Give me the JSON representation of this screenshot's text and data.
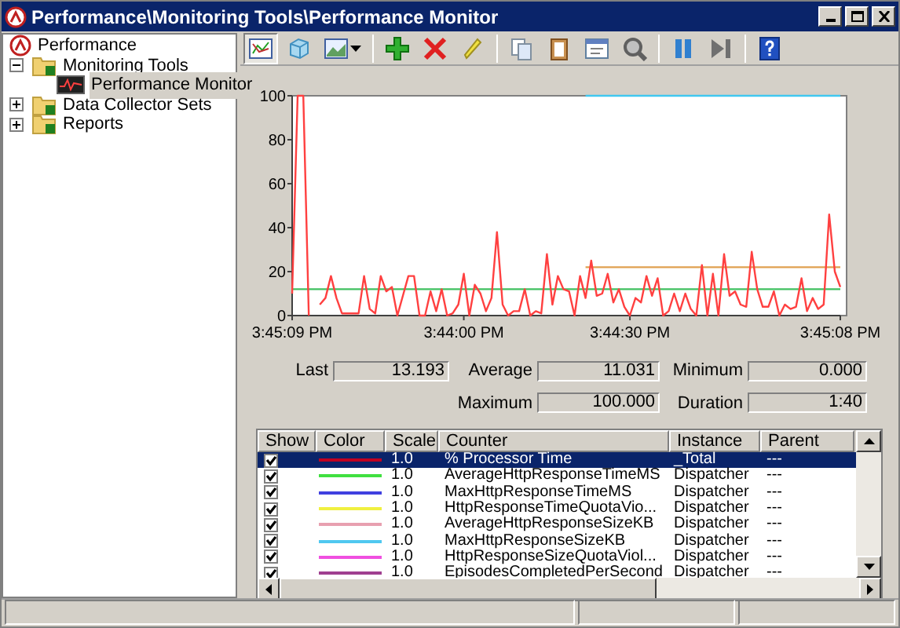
{
  "window": {
    "title": "Performance\\Monitoring Tools\\Performance Monitor"
  },
  "tree": [
    {
      "label": "Performance",
      "kind": "root",
      "selected": false,
      "children": [
        {
          "label": "Monitoring Tools",
          "kind": "folder",
          "selected": false,
          "expanded": true,
          "children": [
            {
              "label": "Performance Monitor",
              "kind": "monitor",
              "selected": true
            }
          ]
        },
        {
          "label": "Data Collector Sets",
          "kind": "folder",
          "selected": false,
          "expanded": false
        },
        {
          "label": "Reports",
          "kind": "folder",
          "selected": false,
          "expanded": false
        }
      ]
    }
  ],
  "toolbar": [
    {
      "kind": "graph",
      "selected": true
    },
    {
      "kind": "freeze",
      "selected": false
    },
    {
      "kind": "view",
      "selected": false
    },
    {
      "kind": "add",
      "selected": false
    },
    {
      "kind": "delete",
      "selected": false
    },
    {
      "kind": "highlight",
      "selected": false
    },
    {
      "kind": "copy",
      "selected": false
    },
    {
      "kind": "paste",
      "selected": false
    },
    {
      "kind": "properties",
      "selected": false
    },
    {
      "kind": "zoom",
      "selected": false
    },
    {
      "kind": "pause",
      "selected": false
    },
    {
      "kind": "step",
      "selected": false
    },
    {
      "kind": "help",
      "selected": false
    }
  ],
  "chart_data": {
    "type": "line",
    "categories": [
      "3:45:09 PM",
      null,
      null,
      null,
      null,
      null,
      null,
      null,
      null,
      null,
      null,
      null,
      null,
      null,
      null,
      null,
      null,
      null,
      null,
      null,
      null,
      null,
      null,
      null,
      null,
      null,
      null,
      null,
      null,
      null,
      null,
      "3:44:00 PM",
      null,
      null,
      null,
      null,
      null,
      null,
      null,
      null,
      null,
      null,
      null,
      null,
      null,
      null,
      null,
      null,
      null,
      null,
      null,
      null,
      null,
      null,
      null,
      null,
      null,
      null,
      null,
      null,
      null,
      "3:44:30 PM",
      null,
      null,
      null,
      null,
      null,
      null,
      null,
      null,
      null,
      null,
      null,
      null,
      null,
      null,
      null,
      null,
      null,
      null,
      null,
      null,
      null,
      null,
      null,
      null,
      null,
      null,
      null,
      null,
      null,
      null,
      null,
      null,
      null,
      null,
      null,
      null,
      null,
      "3:45:08 PM"
    ],
    "ylim": [
      0,
      100
    ],
    "yticks": [
      0,
      20,
      40,
      60,
      80,
      100
    ],
    "series": [
      {
        "color": "#ff4040",
        "values": [
          10,
          100,
          100,
          0,
          null,
          5,
          8,
          18,
          8,
          1,
          1,
          1,
          1,
          18,
          3,
          1,
          18,
          11,
          13,
          0,
          9,
          18,
          18,
          0,
          0,
          11,
          2,
          12,
          0,
          1,
          5,
          19,
          0,
          14,
          10,
          2,
          8,
          38,
          5,
          0,
          2,
          2,
          12,
          0,
          2,
          1,
          28,
          5,
          18,
          12,
          11,
          0,
          18,
          8,
          25,
          9,
          10,
          19,
          6,
          12,
          4,
          0,
          8,
          6,
          18,
          9,
          17,
          0,
          2,
          10,
          2,
          10,
          3,
          0,
          23,
          0,
          19,
          0,
          28,
          9,
          11,
          5,
          4,
          29,
          12,
          4,
          4,
          11,
          0,
          5,
          3,
          4,
          17,
          2,
          8,
          3,
          5,
          46,
          20,
          13
        ]
      },
      {
        "color": "#40c060",
        "values": [
          12,
          12,
          12,
          12,
          12,
          12,
          12,
          12,
          12,
          12,
          12,
          12,
          12,
          12,
          12,
          12,
          12,
          12,
          12,
          12,
          12,
          12,
          12,
          12,
          12,
          12,
          12,
          12,
          12,
          12,
          12,
          12,
          12,
          12,
          12,
          12,
          12,
          12,
          12,
          12,
          12,
          12,
          12,
          12,
          12,
          12,
          12,
          12,
          12,
          12,
          12,
          12,
          12,
          12,
          12,
          12,
          12,
          12,
          12,
          12,
          12,
          12,
          12,
          12,
          12,
          12,
          12,
          12,
          12,
          12,
          12,
          12,
          12,
          12,
          12,
          12,
          12,
          12,
          12,
          12,
          12,
          12,
          12,
          12,
          12,
          12,
          12,
          12,
          12,
          12,
          12,
          12,
          12,
          12,
          12,
          12,
          12,
          12,
          12,
          12
        ]
      },
      {
        "color": "#40c8f0",
        "values": [
          null,
          null,
          null,
          null,
          null,
          null,
          null,
          null,
          null,
          null,
          null,
          null,
          null,
          null,
          null,
          null,
          null,
          null,
          null,
          null,
          null,
          null,
          null,
          null,
          null,
          null,
          null,
          null,
          null,
          null,
          null,
          null,
          null,
          null,
          null,
          null,
          null,
          null,
          null,
          null,
          null,
          null,
          null,
          null,
          null,
          null,
          null,
          null,
          null,
          null,
          null,
          null,
          null,
          100,
          100,
          100,
          100,
          100,
          100,
          100,
          100,
          100,
          100,
          100,
          100,
          100,
          100,
          100,
          100,
          100,
          100,
          100,
          100,
          100,
          100,
          100,
          100,
          100,
          100,
          100,
          100,
          100,
          100,
          100,
          100,
          100,
          100,
          100,
          100,
          100,
          100,
          100,
          100,
          100,
          100,
          100,
          100,
          100,
          100,
          100
        ]
      },
      {
        "color": "#e0a050",
        "values": [
          null,
          null,
          null,
          null,
          null,
          null,
          null,
          null,
          null,
          null,
          null,
          null,
          null,
          null,
          null,
          null,
          null,
          null,
          null,
          null,
          null,
          null,
          null,
          null,
          null,
          null,
          null,
          null,
          null,
          null,
          null,
          null,
          null,
          null,
          null,
          null,
          null,
          null,
          null,
          null,
          null,
          null,
          null,
          null,
          null,
          null,
          null,
          null,
          null,
          null,
          null,
          null,
          null,
          22,
          22,
          22,
          22,
          22,
          22,
          22,
          22,
          22,
          22,
          22,
          22,
          22,
          22,
          22,
          22,
          22,
          22,
          22,
          22,
          22,
          22,
          22,
          22,
          22,
          22,
          22,
          22,
          22,
          22,
          22,
          22,
          22,
          22,
          22,
          22,
          22,
          22,
          22,
          22,
          22,
          22,
          22,
          22,
          22,
          22,
          22
        ]
      }
    ]
  },
  "stats": [
    {
      "label": "Last",
      "value": "13.193"
    },
    {
      "label": "Average",
      "value": "11.031"
    },
    {
      "label": "Minimum",
      "value": "0.000"
    },
    {
      "label": "Maximum",
      "value": "100.000"
    },
    {
      "label": "Duration",
      "value": "1:40"
    }
  ],
  "table": {
    "columns": [
      "Show",
      "Color",
      "Scale",
      "Counter",
      "Instance",
      "Parent"
    ],
    "rows": [
      {
        "checked": true,
        "color": "#c00020",
        "scale": "1.0",
        "counter": "% Processor Time",
        "instance": "_Total",
        "parent": "---",
        "selected": true
      },
      {
        "checked": true,
        "color": "#40e040",
        "scale": "1.0",
        "counter": "AverageHttpResponseTimeMS",
        "instance": "Dispatcher",
        "parent": "---",
        "selected": false
      },
      {
        "checked": true,
        "color": "#4040e0",
        "scale": "1.0",
        "counter": "MaxHttpResponseTimeMS",
        "instance": "Dispatcher",
        "parent": "---",
        "selected": false
      },
      {
        "checked": true,
        "color": "#f0f040",
        "scale": "1.0",
        "counter": "HttpResponseTimeQuotaVio...",
        "instance": "Dispatcher",
        "parent": "---",
        "selected": false
      },
      {
        "checked": true,
        "color": "#e8a0b0",
        "scale": "1.0",
        "counter": "AverageHttpResponseSizeKB",
        "instance": "Dispatcher",
        "parent": "---",
        "selected": false
      },
      {
        "checked": true,
        "color": "#50c8f0",
        "scale": "1.0",
        "counter": "MaxHttpResponseSizeKB",
        "instance": "Dispatcher",
        "parent": "---",
        "selected": false
      },
      {
        "checked": true,
        "color": "#f050e0",
        "scale": "1.0",
        "counter": "HttpResponseSizeQuotaViol...",
        "instance": "Dispatcher",
        "parent": "---",
        "selected": false
      },
      {
        "checked": true,
        "color": "#a04090",
        "scale": "1.0",
        "counter": "EpisodesCompletedPerSecond",
        "instance": "Dispatcher",
        "parent": "---",
        "selected": false
      }
    ]
  }
}
